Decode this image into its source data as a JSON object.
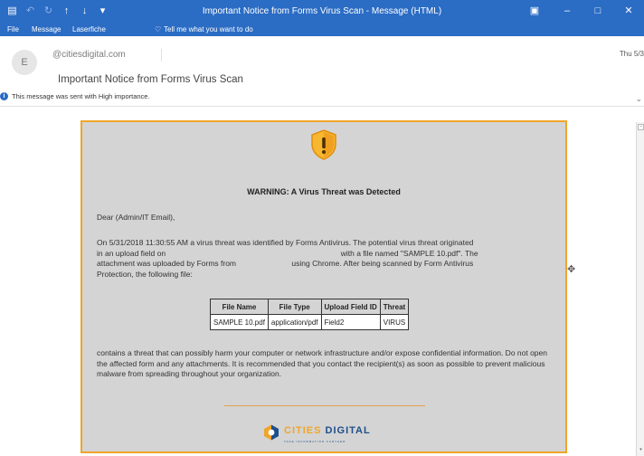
{
  "window": {
    "title": "Important Notice from Forms Virus Scan  -  Message (HTML)"
  },
  "ribbon": {
    "tabs": [
      "File",
      "Message",
      "Laserfiche"
    ],
    "tell_me": "Tell me what you want to do"
  },
  "header": {
    "avatar_initial": "E",
    "sender": "@citiesdigital.com",
    "subject": "Important Notice from Forms Virus Scan",
    "date": "Thu 5/3",
    "importance": "This message was sent with High importance."
  },
  "email": {
    "warning": "WARNING: A Virus Threat was Detected",
    "greeting": "Dear (Admin/IT Email),",
    "para1_lines": [
      "On 5/31/2018 11:30:55 AM a virus threat was identified by Forms Antivirus. The potential virus threat originated",
      "in an upload field on                                                                                  with a file named \"SAMPLE 10.pdf\". The",
      "attachment was uploaded by Forms from                          using Chrome. After being scanned by Form Antivirus",
      "Protection, the following file:"
    ],
    "table": {
      "headers": [
        "File Name",
        "File Type",
        "Upload Field ID",
        "Threat"
      ],
      "rows": [
        [
          "SAMPLE 10.pdf",
          "application/pdf",
          "Field2",
          "VIRUS"
        ]
      ]
    },
    "para2": "contains a threat that can possibly harm your computer or network infrastructure and/or expose confidential information. Do not open the affected form and any attachments. It is recommended that you contact the recipient(s) as soon as possible to prevent malicious malware from spreading throughout your organization.",
    "logo": {
      "name_a": "CITIES",
      "name_b": "DIGITAL",
      "tagline": "TAKE INFORMATION FURTHER"
    }
  },
  "colors": {
    "titlebar": "#2b6cc4",
    "accent_orange": "#f0a52a",
    "card_bg": "#d4d4d4",
    "brand_blue": "#1d4f8c"
  }
}
